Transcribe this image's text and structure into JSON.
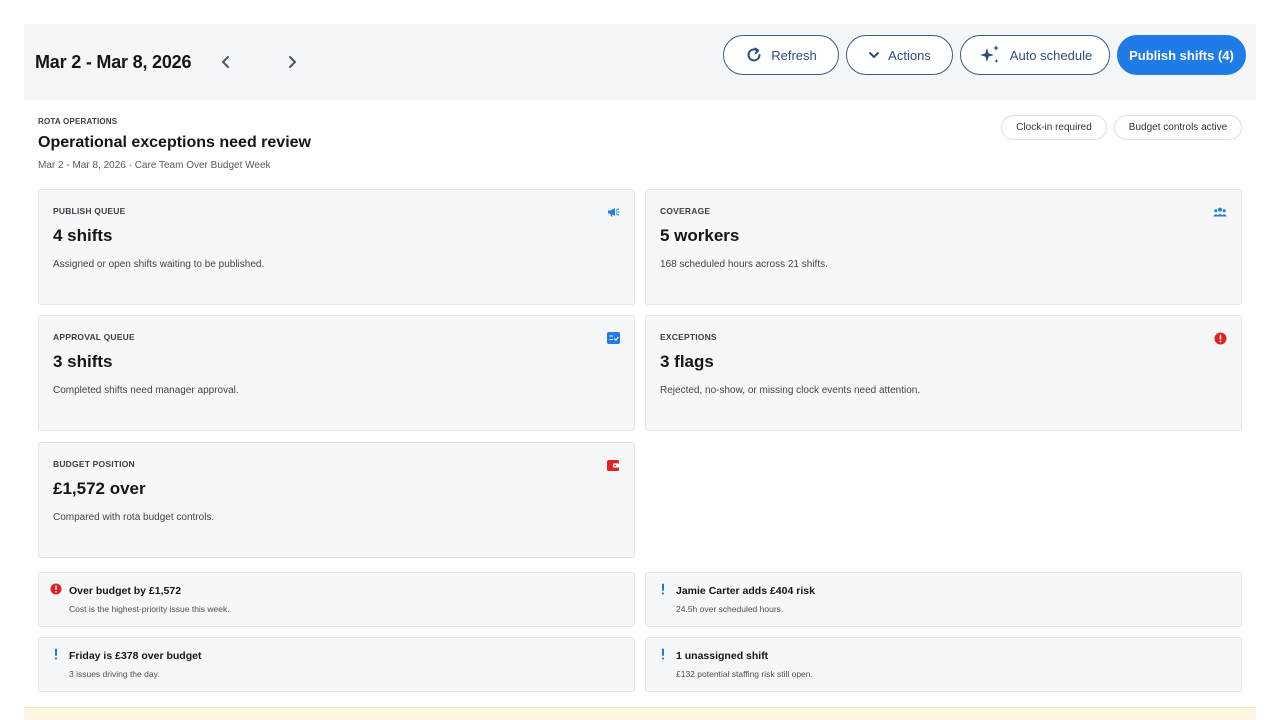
{
  "header": {
    "date_range": "Mar 2 - Mar 8, 2026",
    "prev_icon": "chevron-left-icon",
    "next_icon": "chevron-right-icon",
    "buttons": {
      "refresh": {
        "label": "Refresh",
        "icon": "refresh-icon"
      },
      "actions": {
        "label": "Actions",
        "icon": "chevron-down-icon"
      },
      "auto": {
        "label": "Auto schedule",
        "icon": "sparkle-icon"
      },
      "publish": {
        "label": "Publish shifts (4)"
      }
    }
  },
  "section": {
    "kicker": "ROTA OPERATIONS",
    "title": "Operational exceptions need review",
    "subtitle": "Mar 2 - Mar 8, 2026 · Care Team Over Budget Week",
    "chips": [
      "Clock-in required",
      "Budget controls active"
    ]
  },
  "cards": [
    {
      "label": "PUBLISH QUEUE",
      "value": "4 shifts",
      "desc": "Assigned or open shifts waiting to be published.",
      "icon": "megaphone-icon"
    },
    {
      "label": "COVERAGE",
      "value": "5 workers",
      "desc": "168 scheduled hours across 21 shifts.",
      "icon": "people-icon"
    },
    {
      "label": "APPROVAL QUEUE",
      "value": "3 shifts",
      "desc": "Completed shifts need manager approval.",
      "icon": "checklist-icon"
    },
    {
      "label": "EXCEPTIONS",
      "value": "3 flags",
      "desc": "Rejected, no-show, or missing clock events need attention.",
      "icon": "error-icon"
    },
    {
      "label": "BUDGET POSITION",
      "value": "£1,572 over",
      "desc": "Compared with rota budget controls.",
      "icon": "wallet-icon"
    }
  ],
  "alerts": [
    {
      "title": "Over budget by £1,572",
      "desc": "Cost is the highest-priority issue this week.",
      "icon": "error-icon"
    },
    {
      "title": "Jamie Carter adds £404 risk",
      "desc": "24.5h over scheduled hours.",
      "icon": "exclamation-icon"
    },
    {
      "title": "Friday is £378 over budget",
      "desc": "3 issues driving the day.",
      "icon": "exclamation-icon"
    },
    {
      "title": "1 unassigned shift",
      "desc": "£132 potential staffing risk still open.",
      "icon": "exclamation-icon"
    }
  ],
  "colors": {
    "primary": "#1f7be8",
    "danger": "#e02424",
    "info": "#1f7be8",
    "border": "#e3e5e8"
  }
}
